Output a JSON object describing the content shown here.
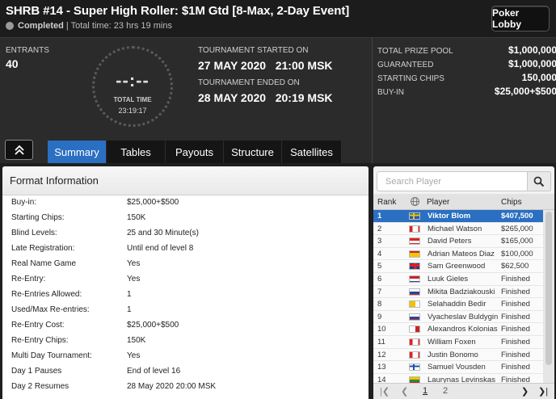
{
  "header": {
    "title": "SHRB #14 - Super High Roller: $1M Gtd [8-Max, 2-Day Event]",
    "status": "Completed",
    "total_time": "| Total time: 23 hrs 19 mins",
    "lobby_button": "Poker Lobby"
  },
  "info": {
    "entrants_label": "ENTRANTS",
    "entrants_value": "40",
    "clock_digits": "--:--",
    "clock_label": "TOTAL TIME",
    "clock_time": "23:19:17",
    "started_label": "TOURNAMENT STARTED ON",
    "started_value": "27 MAY 2020   21:00 MSK",
    "ended_label": "TOURNAMENT ENDED ON",
    "ended_value": "28 MAY 2020   20:19 MSK"
  },
  "prize": [
    {
      "label": "TOTAL PRIZE POOL",
      "value": "$1,000,000"
    },
    {
      "label": "GUARANTEED",
      "value": "$1,000,000"
    },
    {
      "label": "STARTING CHIPS",
      "value": "150,000"
    },
    {
      "label": "BUY-IN",
      "value": "$25,000+$500"
    }
  ],
  "tabs": [
    "Summary",
    "Tables",
    "Payouts",
    "Structure",
    "Satellites"
  ],
  "active_tab": "Summary",
  "format": {
    "title": "Format Information",
    "rows": [
      {
        "label": "Buy-in:",
        "value": "$25,000+$500"
      },
      {
        "label": "Starting Chips:",
        "value": "150K"
      },
      {
        "label": "Blind Levels:",
        "value": "25 and 30 Minute(s)"
      },
      {
        "label": "Late Registration:",
        "value": "Until end of level 8"
      },
      {
        "label": "Real Name Game",
        "value": "Yes"
      },
      {
        "label": "Re-Entry:",
        "value": "Yes"
      },
      {
        "label": "Re-Entries Allowed:",
        "value": "1"
      },
      {
        "label": "Used/Max Re-entries:",
        "value": "1"
      },
      {
        "label": "Re-Entry Cost:",
        "value": "$25,000+$500"
      },
      {
        "label": "Re-Entry Chips:",
        "value": "150K"
      },
      {
        "label": "Multi Day Tournament:",
        "value": "Yes"
      },
      {
        "label": "Day 1 Pauses",
        "value": "End of level 16"
      },
      {
        "label": "Day 2 Resumes",
        "value": "28 May 2020  20:00 MSK"
      }
    ]
  },
  "players": {
    "search_placeholder": "Search Player",
    "columns": {
      "rank": "Rank",
      "player": "Player",
      "chips": "Chips"
    },
    "rows": [
      {
        "rank": "1",
        "flag": "se",
        "name": "Viktor Blom",
        "chips": "$407,500"
      },
      {
        "rank": "2",
        "flag": "ca",
        "name": "Michael Watson",
        "chips": "$265,000"
      },
      {
        "rank": "3",
        "flag": "at",
        "name": "David Peters",
        "chips": "$165,000"
      },
      {
        "rank": "4",
        "flag": "es",
        "name": "Adrian Mateos Diaz",
        "chips": "$100,000"
      },
      {
        "rank": "5",
        "flag": "gb",
        "name": "Sam Greenwood",
        "chips": "$62,500"
      },
      {
        "rank": "6",
        "flag": "nl",
        "name": "Luuk Gieles",
        "chips": "Finished"
      },
      {
        "rank": "7",
        "flag": "sk",
        "name": "Mikita Badziakouski",
        "chips": "Finished"
      },
      {
        "rank": "8",
        "flag": "va",
        "name": "Selahaddin Bedir",
        "chips": "Finished"
      },
      {
        "rank": "9",
        "flag": "ru",
        "name": "Vyacheslav Buldygin",
        "chips": "Finished"
      },
      {
        "rank": "10",
        "flag": "mt",
        "name": "Alexandros Kolonias",
        "chips": "Finished"
      },
      {
        "rank": "11",
        "flag": "ca",
        "name": "William Foxen",
        "chips": "Finished"
      },
      {
        "rank": "12",
        "flag": "ca",
        "name": "Justin Bonomo",
        "chips": "Finished"
      },
      {
        "rank": "13",
        "flag": "fi",
        "name": "Samuel Vousden",
        "chips": "Finished"
      },
      {
        "rank": "14",
        "flag": "lt",
        "name": "Laurynas Levinskas",
        "chips": "Finished"
      }
    ],
    "pager": {
      "page1": "1",
      "page2": "2"
    }
  },
  "colors": {
    "accent": "#2a6fc2",
    "background": "#1f1f1f"
  }
}
